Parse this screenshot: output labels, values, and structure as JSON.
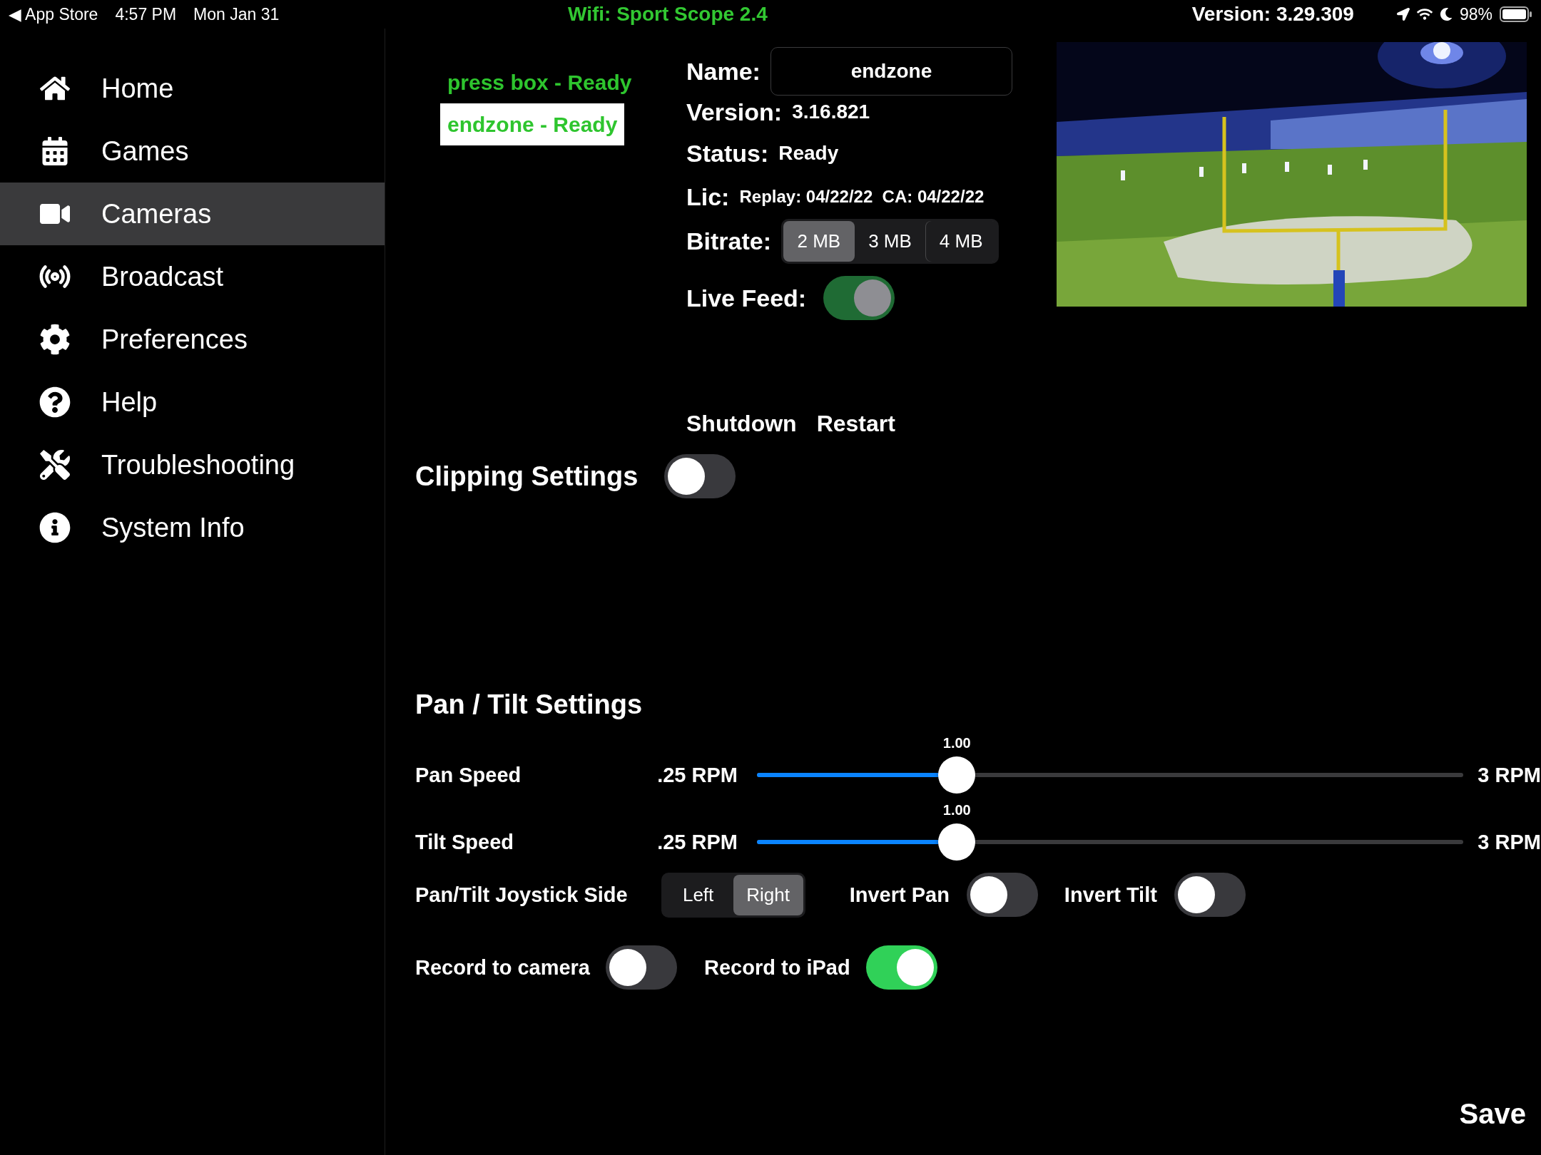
{
  "status_bar": {
    "back": "◀ App Store",
    "time": "4:57 PM",
    "date": "Mon Jan 31",
    "network": "Wifi: Sport Scope 2.4",
    "version": "Version: 3.29.309",
    "battery": "98%"
  },
  "sidebar": {
    "items": [
      {
        "label": "Home",
        "selected": false
      },
      {
        "label": "Games",
        "selected": false
      },
      {
        "label": "Cameras",
        "selected": true
      },
      {
        "label": "Broadcast",
        "selected": false
      },
      {
        "label": "Preferences",
        "selected": false
      },
      {
        "label": "Help",
        "selected": false
      },
      {
        "label": "Troubleshooting",
        "selected": false
      },
      {
        "label": "System Info",
        "selected": false
      }
    ]
  },
  "cameras": [
    {
      "label": "press box - Ready",
      "selected": false
    },
    {
      "label": "endzone - Ready",
      "selected": true
    }
  ],
  "details": {
    "name_label": "Name:",
    "name_value": "endzone",
    "version_label": "Version:",
    "version_value": "3.16.821",
    "status_label": "Status:",
    "status_value": "Ready",
    "lic_label": "Lic:",
    "lic_value": "Replay: 04/22/22  CA: 04/22/22",
    "bitrate_label": "Bitrate:",
    "bitrate_options": [
      {
        "label": "2 MB",
        "selected": true
      },
      {
        "label": "3 MB",
        "selected": false
      },
      {
        "label": "4 MB",
        "selected": false
      }
    ],
    "live_feed": {
      "label": "Live Feed:",
      "on": true,
      "disabled": true
    }
  },
  "actions": [
    "Shutdown",
    "Restart"
  ],
  "clipping": {
    "label": "Clipping Settings",
    "on": false
  },
  "pan_tilt": {
    "title": "Pan / Tilt Settings",
    "sliders": [
      {
        "label": "Pan Speed",
        "min_label": ".25 RPM",
        "max_label": "3 RPM",
        "value_label": "1.00",
        "level": 0.283
      },
      {
        "label": "Tilt Speed",
        "min_label": ".25 RPM",
        "max_label": "3 RPM",
        "value_label": "1.00",
        "level": 0.283
      }
    ],
    "joystick": {
      "label": "Pan/Tilt Joystick Side",
      "options": [
        {
          "label": "Left",
          "selected": false
        },
        {
          "label": "Right",
          "selected": true
        }
      ]
    },
    "invert": [
      {
        "label": "Invert Pan",
        "on": false
      },
      {
        "label": "Invert Tilt",
        "on": false
      }
    ],
    "record": [
      {
        "label": "Record to camera",
        "on": false
      },
      {
        "label": "Record to iPad",
        "on": true
      }
    ]
  },
  "save": "Save"
}
